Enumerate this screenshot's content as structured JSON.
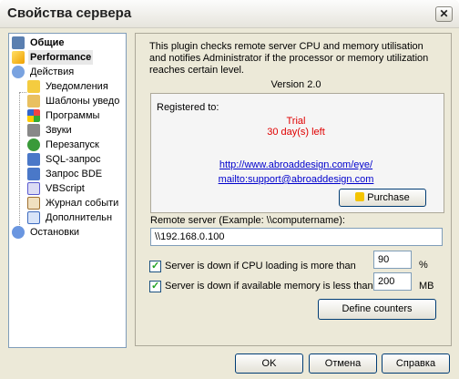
{
  "window": {
    "title": "Свойства сервера",
    "close_glyph": "✕"
  },
  "tree": {
    "items": [
      {
        "label": "Общие",
        "icon": "properties-icon",
        "color": "#5a7fb0"
      },
      {
        "label": "Performance",
        "icon": "lightning-icon",
        "color": "#f4c400"
      },
      {
        "label": "Действия",
        "icon": "magnifier-icon",
        "color": "#3d6bbf"
      },
      {
        "label": "Уведомления",
        "icon": "envelope-icon",
        "color": "#f0c020"
      },
      {
        "label": "Шаблоны уведо",
        "icon": "templates-icon",
        "color": "#e4b040"
      },
      {
        "label": "Программы",
        "icon": "windows-icon",
        "color": "#3a8c2a"
      },
      {
        "label": "Звуки",
        "icon": "speaker-icon",
        "color": "#6a6a6a"
      },
      {
        "label": "Перезапуск",
        "icon": "restart-icon",
        "color": "#2a8a2a"
      },
      {
        "label": "SQL-запрос",
        "icon": "sql-icon",
        "color": "#3d6bbf"
      },
      {
        "label": "Запрос BDE",
        "icon": "bde-icon",
        "color": "#3d6bbf"
      },
      {
        "label": "VBScript",
        "icon": "script-icon",
        "color": "#5a5ad0"
      },
      {
        "label": "Журнал событи",
        "icon": "journal-icon",
        "color": "#a07030"
      },
      {
        "label": "Дополнительн",
        "icon": "extra-icon",
        "color": "#3d6bbf"
      },
      {
        "label": "Остановки",
        "icon": "clock-icon",
        "color": "#3d6bbf"
      }
    ]
  },
  "plugin": {
    "description": "This plugin checks remote server CPU and memory utilisation and notifies Administrator if the processor or memory utilization reaches certain level.",
    "version": "Version 2.0",
    "registered_label": "Registered to:",
    "trial": "Trial",
    "trial_days": "30 day(s) left",
    "url": "http://www.abroaddesign.com/eye/",
    "email": "mailto:support@abroaddesign.com",
    "purchase_label": "Purchase"
  },
  "server": {
    "label": "Remote server (Example: \\\\computername):",
    "value": "\\\\192.168.0.100"
  },
  "cpu": {
    "label": "Server is down if CPU loading is more than",
    "value": "90",
    "unit": "%",
    "checked": true
  },
  "memory": {
    "label": "Server is down if available memory is less than",
    "value": "200",
    "unit": "MB",
    "checked": true
  },
  "define_counters_label": "Define counters",
  "buttons": {
    "ok": "OK",
    "cancel": "Отмена",
    "help": "Справка"
  }
}
